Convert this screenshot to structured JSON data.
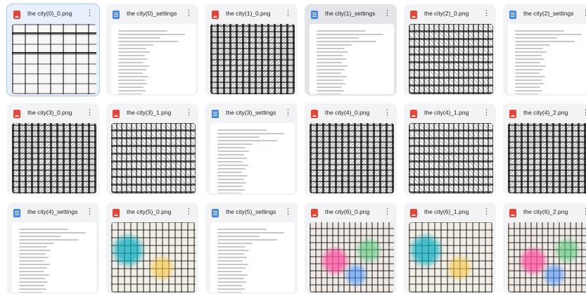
{
  "files": [
    {
      "name": "the city(0)_0.png",
      "kind": "image",
      "art": "sketch light",
      "state": "selected"
    },
    {
      "name": "the city(0)_settings",
      "kind": "doc",
      "art": "doc",
      "state": ""
    },
    {
      "name": "the city(1)_0.png",
      "kind": "image",
      "art": "sketch v2",
      "state": ""
    },
    {
      "name": "the city(1)_settings",
      "kind": "doc",
      "art": "doc",
      "state": "hover"
    },
    {
      "name": "the city(2)_0.png",
      "kind": "image",
      "art": "sketch",
      "state": ""
    },
    {
      "name": "the city(2)_settings",
      "kind": "doc",
      "art": "doc",
      "state": ""
    },
    {
      "name": "the city(3)_0.png",
      "kind": "image",
      "art": "sketch v2",
      "state": ""
    },
    {
      "name": "the city(3)_1.png",
      "kind": "image",
      "art": "sketch",
      "state": ""
    },
    {
      "name": "the city(3)_settings",
      "kind": "doc",
      "art": "doc",
      "state": ""
    },
    {
      "name": "the city(4)_0.png",
      "kind": "image",
      "art": "sketch v2",
      "state": ""
    },
    {
      "name": "the city(4)_1.png",
      "kind": "image",
      "art": "sketch",
      "state": ""
    },
    {
      "name": "the city(4)_2.png",
      "kind": "image",
      "art": "sketch v2",
      "state": ""
    },
    {
      "name": "the city(4)_settings",
      "kind": "doc",
      "art": "doc",
      "state": ""
    },
    {
      "name": "the city(5)_0.png",
      "kind": "image",
      "art": "color teal",
      "state": ""
    },
    {
      "name": "the city(5)_settings",
      "kind": "doc",
      "art": "doc",
      "state": ""
    },
    {
      "name": "the city(6)_0.png",
      "kind": "image",
      "art": "color",
      "state": ""
    },
    {
      "name": "the city(6)_1.png",
      "kind": "image",
      "art": "color teal",
      "state": ""
    },
    {
      "name": "the city(6)_2.png",
      "kind": "image",
      "art": "color",
      "state": ""
    }
  ],
  "more_icon": "⋮",
  "colors": {
    "image_icon": "#ea4335",
    "doc_icon": "#4285f4",
    "selected_bg": "#e8f0fe"
  }
}
